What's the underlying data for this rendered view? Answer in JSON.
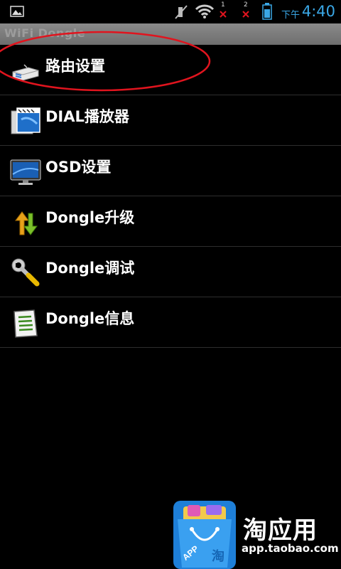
{
  "status_bar": {
    "ampm": "下午",
    "time": "4:40",
    "sim1": "1",
    "sim2": "2",
    "icons": [
      "image-icon",
      "mute-icon",
      "wifi-icon",
      "signal-icon",
      "signal-icon",
      "battery-icon"
    ],
    "accent_color": "#3aa7e6"
  },
  "title_bar": {
    "title": "WiFi Dongle"
  },
  "menu": {
    "items": [
      {
        "label": "路由设置",
        "icon": "router-icon"
      },
      {
        "label": "DIAL播放器",
        "icon": "video-player-icon"
      },
      {
        "label": "OSD设置",
        "icon": "monitor-icon"
      },
      {
        "label": "Dongle升级",
        "icon": "upgrade-arrows-icon"
      },
      {
        "label": "Dongle调试",
        "icon": "wrench-icon"
      },
      {
        "label": "Dongle信息",
        "icon": "document-icon"
      }
    ]
  },
  "promo": {
    "brand": "淘应用",
    "url": "app.taobao.com",
    "bag_text": "APP",
    "bag_char": "淘"
  },
  "colors": {
    "annotation": "#e0141e",
    "divider": "#2e2e2e"
  }
}
